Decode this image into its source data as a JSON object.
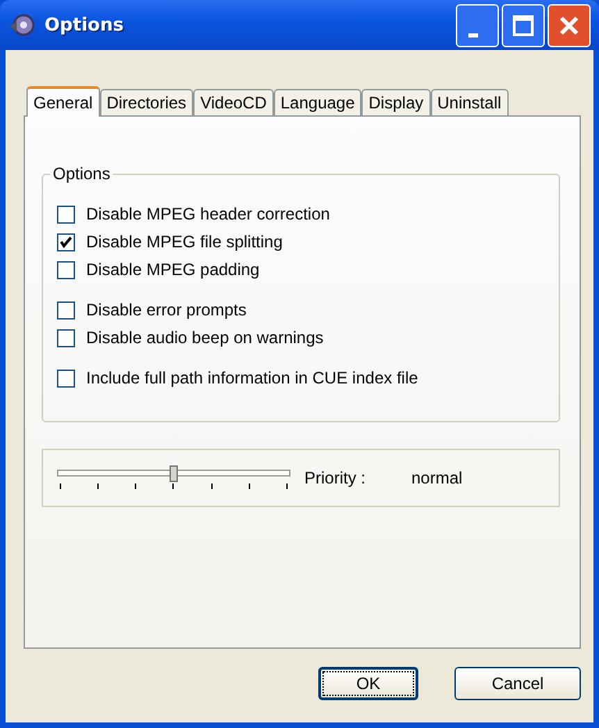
{
  "window": {
    "title": "Options"
  },
  "tabs": [
    {
      "label": "General",
      "selected": true
    },
    {
      "label": "Directories",
      "selected": false
    },
    {
      "label": "VideoCD",
      "selected": false
    },
    {
      "label": "Language",
      "selected": false
    },
    {
      "label": "Display",
      "selected": false
    },
    {
      "label": "Uninstall",
      "selected": false
    }
  ],
  "options_group": {
    "title": "Options",
    "checkbox_groups": [
      [
        {
          "label": "Disable MPEG header correction",
          "checked": false
        },
        {
          "label": "Disable MPEG file splitting",
          "checked": true
        },
        {
          "label": "Disable MPEG padding",
          "checked": false
        }
      ],
      [
        {
          "label": "Disable error prompts",
          "checked": false
        },
        {
          "label": "Disable audio beep on warnings",
          "checked": false
        }
      ],
      [
        {
          "label": "Include full path information in CUE index file",
          "checked": false
        }
      ]
    ]
  },
  "priority": {
    "level": 0.5,
    "label": "Priority :",
    "value": "normal"
  },
  "buttons": [
    {
      "label": "OK",
      "default": true
    },
    {
      "label": "Cancel",
      "default": false
    }
  ]
}
